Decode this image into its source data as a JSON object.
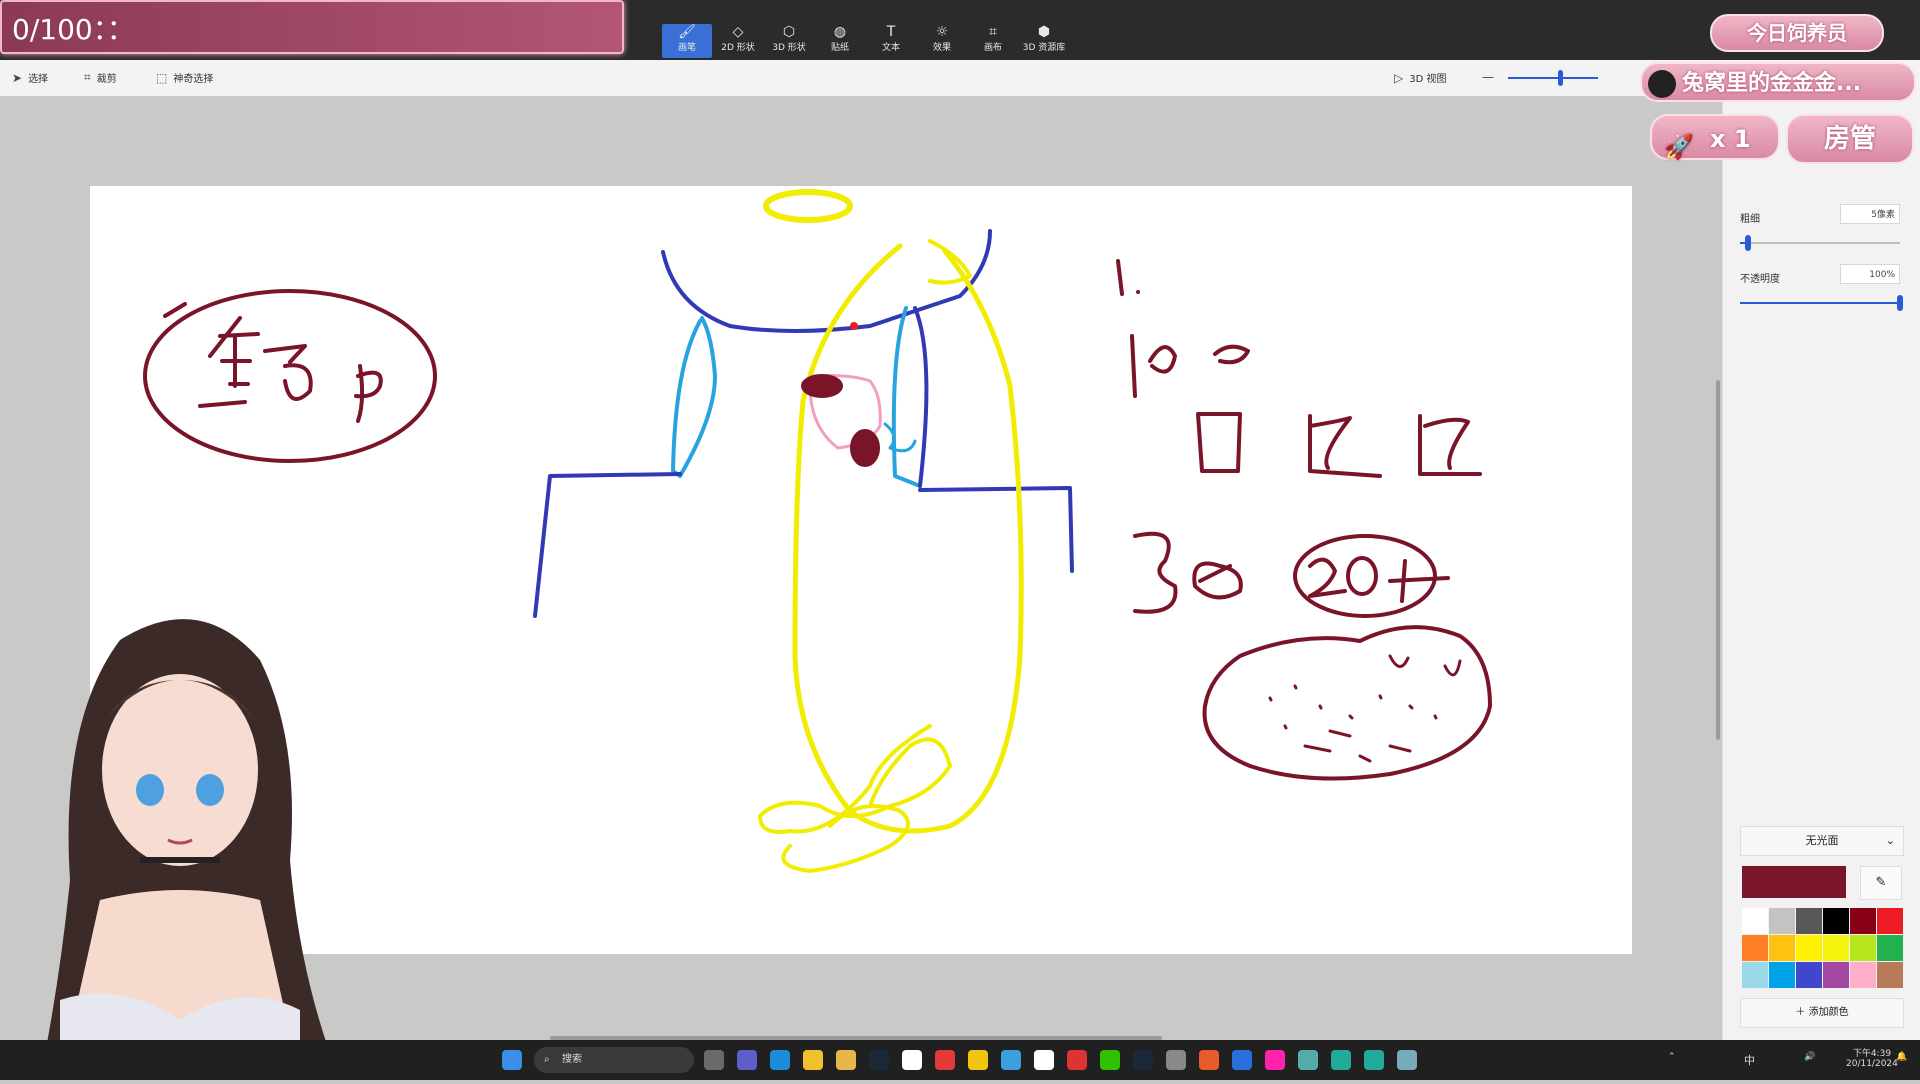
{
  "counter": {
    "text": "0/100：："
  },
  "ribbon_tools": [
    {
      "label": "画笔",
      "icon": "brush-icon",
      "active": true
    },
    {
      "label": "2D 形状",
      "icon": "shape-2d-icon"
    },
    {
      "label": "3D 形状",
      "icon": "shape-3d-icon"
    },
    {
      "label": "贴纸",
      "icon": "sticker-icon"
    },
    {
      "label": "文本",
      "icon": "text-icon"
    },
    {
      "label": "效果",
      "icon": "effects-icon"
    },
    {
      "label": "画布",
      "icon": "canvas-icon"
    },
    {
      "label": "3D 资源库",
      "icon": "library-3d-icon"
    }
  ],
  "commands": {
    "select": "选择",
    "crop": "裁剪",
    "magic_select": "神奇选择",
    "view3d": "3D 视图"
  },
  "overlay": {
    "title": "今日饲养员",
    "user": "兔窝里的金金金...",
    "count": "x 1",
    "role": "房管"
  },
  "panel": {
    "thickness_label": "粗细",
    "thickness_value": "5像素",
    "thickness_fraction": 0.05,
    "opacity_label": "不透明度",
    "opacity_value": "100%",
    "opacity_fraction": 1.0,
    "finish": "无光面",
    "current_color": "#7a1428",
    "add_color": "添加颜色",
    "palette": [
      "#ffffff",
      "#c3c3c3",
      "#585858",
      "#000000",
      "#880015",
      "#ed1c24",
      "#ff7f27",
      "#ffc20e",
      "#fff200",
      "#f4f40e",
      "#b5e61d",
      "#22b14c",
      "#99d9ea",
      "#00a2e8",
      "#3f48cc",
      "#a349a4",
      "#ffaec9",
      "#b97a57"
    ]
  },
  "taskbar": {
    "search": "搜索",
    "time": "下午4:39",
    "date": "20/11/2024",
    "ime": "中"
  }
}
